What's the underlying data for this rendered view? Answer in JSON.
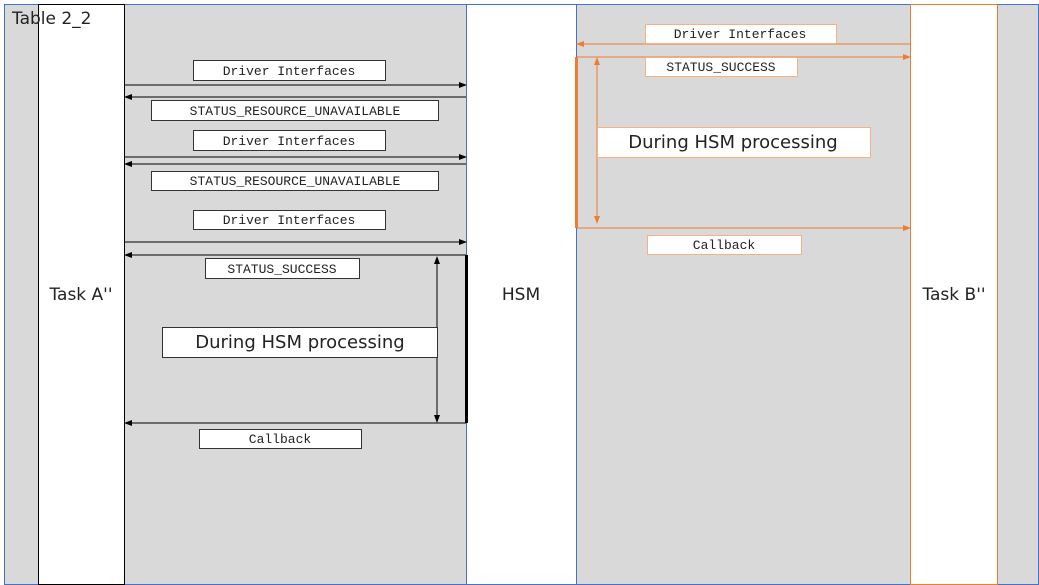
{
  "title": "Table 2_2",
  "lanes": {
    "task_a": "Task A''",
    "hsm": "HSM",
    "task_b": "Task B''"
  },
  "task_a_messages": {
    "driver_interfaces_1": "Driver Interfaces",
    "status_unavailable_1": "STATUS_RESOURCE_UNAVAILABLE",
    "driver_interfaces_2": "Driver Interfaces",
    "status_unavailable_2": "STATUS_RESOURCE_UNAVAILABLE",
    "driver_interfaces_3": "Driver Interfaces",
    "status_success": "STATUS_SUCCESS",
    "during_processing": "During HSM processing",
    "callback": "Callback"
  },
  "task_b_messages": {
    "driver_interfaces": "Driver Interfaces",
    "status_success": "STATUS_SUCCESS",
    "during_processing": "During HSM processing",
    "callback": "Callback"
  },
  "colors": {
    "background": "#d9d9d9",
    "task_a": "#000000",
    "hsm": "#4472c4",
    "task_b": "#ed7d31"
  }
}
